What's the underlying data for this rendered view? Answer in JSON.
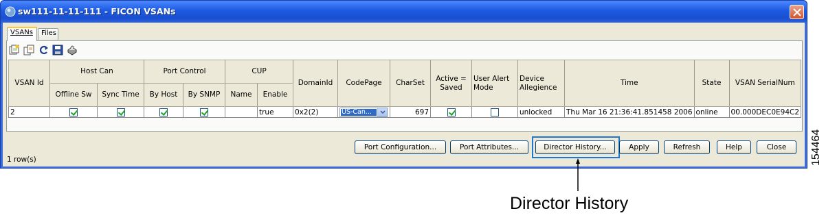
{
  "window": {
    "title": "sw111-11-11-111 - FICON VSANs",
    "colors": {
      "title_bar": "#1d5ae0",
      "client": "#ece9d8",
      "selection": "#316ac5"
    }
  },
  "tabs": [
    {
      "label": "VSANs",
      "active": true
    },
    {
      "label": "Files",
      "active": false
    }
  ],
  "toolbar": {
    "icons": [
      "create-row-icon",
      "copy-row-icon",
      "refresh-icon",
      "save-icon",
      "print-icon"
    ]
  },
  "table": {
    "headers": {
      "vsan_id": "VSAN Id",
      "host_can": "Host Can",
      "offline_sw": "Offline Sw",
      "sync_time": "Sync Time",
      "port_control": "Port Control",
      "by_host": "By Host",
      "by_snmp": "By SNMP",
      "cup": "CUP",
      "name": "Name",
      "enable": "Enable",
      "domain_id": "DomainId",
      "codepage": "CodePage",
      "charset": "CharSet",
      "active_saved": "Active = Saved",
      "user_alert_mode": "User Alert Mode",
      "device_allegience": "Device Allegience",
      "time": "Time",
      "state": "State",
      "vsan_serial": "VSAN SerialNum"
    },
    "row": {
      "vsan_id": "2",
      "offline_sw": true,
      "sync_time": true,
      "by_host": true,
      "by_snmp": true,
      "name": "",
      "enable": "true",
      "domain_id": "0x2(2)",
      "codepage": "US-Can...",
      "charset": "697",
      "active_saved": true,
      "user_alert_mode": false,
      "device_allegience": "unlocked",
      "time": "Thu Mar 16 21:36:41.851458 2006",
      "state": "online",
      "vsan_serial": "00.000DEC0E94C2"
    }
  },
  "buttons": {
    "port_configuration": "Port Configuration...",
    "port_attributes": "Port Attributes...",
    "director_history": "Director History...",
    "apply": "Apply",
    "refresh": "Refresh",
    "help": "Help",
    "close": "Close"
  },
  "status": {
    "row_count": "1 row(s)"
  },
  "annotation": {
    "callout": "Director History",
    "figure_id": "154464"
  }
}
